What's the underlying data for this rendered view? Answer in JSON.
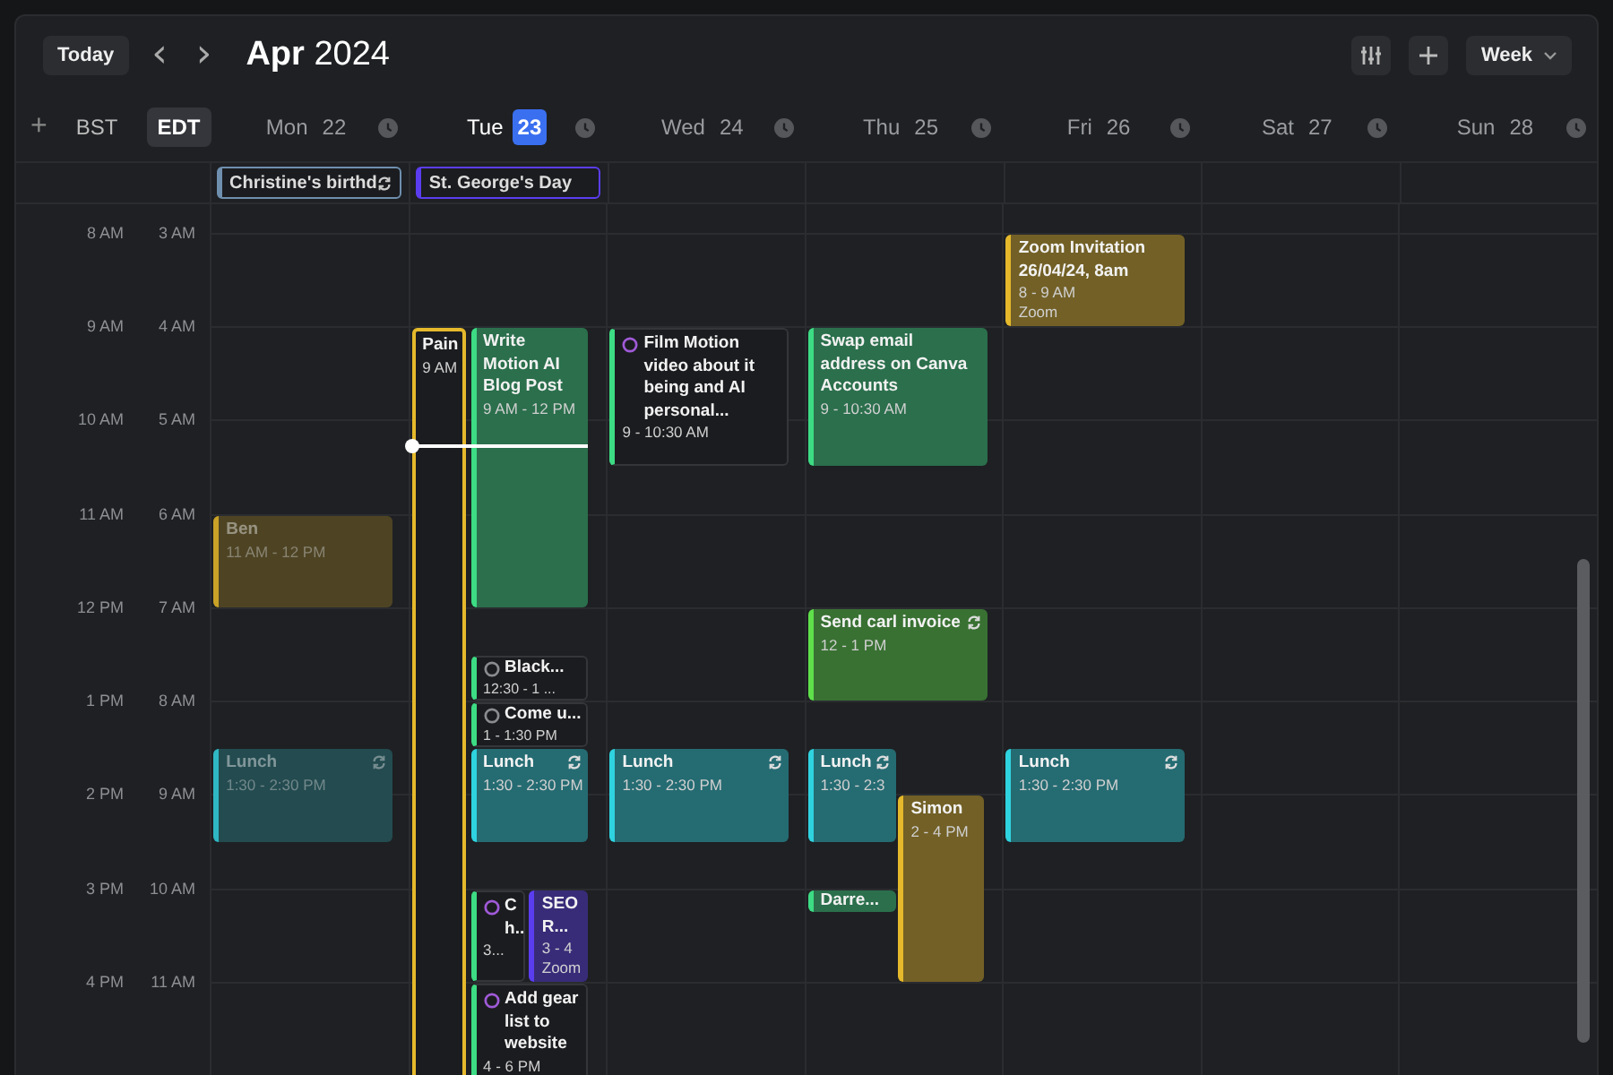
{
  "toolbar": {
    "today": "Today",
    "prev": "‹",
    "next": "›",
    "title": "**Apr** 2024",
    "view": "Week"
  },
  "timezones": {
    "add": "+",
    "zones": [
      {
        "label": "BST",
        "selected": false
      },
      {
        "label": "EDT",
        "selected": true
      }
    ]
  },
  "hours": [
    {
      "primary": "8 AM",
      "secondary": "3 AM"
    },
    {
      "primary": "9 AM",
      "secondary": "4 AM"
    },
    {
      "primary": "10 AM",
      "secondary": "5 AM"
    },
    {
      "primary": "11 AM",
      "secondary": "6 AM"
    },
    {
      "primary": "12 PM",
      "secondary": "7 AM"
    },
    {
      "primary": "1 PM",
      "secondary": "8 AM"
    },
    {
      "primary": "2 PM",
      "secondary": "9 AM"
    },
    {
      "primary": "3 PM",
      "secondary": "10 AM"
    },
    {
      "primary": "4 PM",
      "secondary": "11 AM"
    }
  ],
  "days": [
    {
      "weekday": "Mon",
      "date": "22",
      "selected": false,
      "all_day": [
        {
          "title": "Christine's birthd",
          "color": "#6f8fae",
          "recurring": true
        }
      ],
      "events": [
        {
          "kind": "event",
          "title": "Ben",
          "time": "11 AM - 12 PM",
          "color": "#c9a227",
          "dimmed": true,
          "recurring": false
        },
        {
          "kind": "event",
          "title": "Lunch",
          "time": "1:30 - 2:30 PM",
          "color": "#2fb8c4",
          "dimmed": true,
          "recurring": true
        }
      ]
    },
    {
      "weekday": "Tue",
      "date": "23",
      "selected": true,
      "all_day": [
        {
          "title": "St. George's Day",
          "color": "#5b3df0",
          "recurring": false
        }
      ],
      "events": [
        {
          "kind": "outlined",
          "title": "Pain",
          "time": "9 AM",
          "color": "#e5b92b",
          "dimmed": false,
          "recurring": false
        },
        {
          "kind": "event",
          "title": "Write Motion AI Blog Post",
          "time": "9 AM - 12 PM",
          "color": "#3ddc84",
          "dimmed": false,
          "recurring": false
        },
        {
          "kind": "task",
          "title": "Black...",
          "time": "12:30 - 1 ...",
          "color": "#3ddc84",
          "task": {
            "color": "#8a8c90"
          },
          "dimmed": false,
          "recurring": false
        },
        {
          "kind": "task",
          "title": "Come u...",
          "time": "1 - 1:30 PM",
          "color": "#3ddc84",
          "task": {
            "color": "#8a8c90"
          },
          "dimmed": false,
          "recurring": false
        },
        {
          "kind": "event",
          "title": "Lunch",
          "time": "1:30 - 2:30 PM",
          "color": "#2fd3e0",
          "dimmed": false,
          "recurring": true
        },
        {
          "kind": "task",
          "title": "C h..",
          "time": "3...",
          "color": "#3ddc84",
          "task": {
            "color": "#a05ad8"
          },
          "dimmed": false,
          "recurring": false
        },
        {
          "kind": "event",
          "title": "SEO R...",
          "time": "3 - 4",
          "location": "Zoom",
          "color": "#5b3df0",
          "dimmed": false,
          "recurring": false
        },
        {
          "kind": "task",
          "title": "Add gear list to website",
          "time": "4 - 6 PM",
          "color": "#3ddc84",
          "task": {
            "color": "#a05ad8"
          },
          "dimmed": false,
          "recurring": false
        }
      ]
    },
    {
      "weekday": "Wed",
      "date": "24",
      "selected": false,
      "events": [
        {
          "kind": "task",
          "title": "Film Motion video about it being and AI personal...",
          "time": "9 - 10:30 AM",
          "color": "#3ddc84",
          "task": {
            "color": "#a05ad8"
          },
          "dimmed": false,
          "recurring": false
        },
        {
          "kind": "event",
          "title": "Lunch",
          "time": "1:30 - 2:30 PM",
          "color": "#2fd3e0",
          "dimmed": false,
          "recurring": true
        }
      ]
    },
    {
      "weekday": "Thu",
      "date": "25",
      "selected": false,
      "events": [
        {
          "kind": "event",
          "title": "Swap email address on Canva Accounts",
          "time": "9 - 10:30 AM",
          "color": "#3ddc84",
          "dimmed": false,
          "recurring": false
        },
        {
          "kind": "event",
          "title": "Send carl invoice",
          "time": "12 - 1 PM",
          "color": "#5fe04a",
          "dimmed": false,
          "recurring": true
        },
        {
          "kind": "event",
          "title": "Lunch",
          "time": "1:30 - 2:3",
          "color": "#2fd3e0",
          "dimmed": false,
          "recurring": true
        },
        {
          "kind": "event",
          "title": "Simon",
          "time": "2 - 4 PM",
          "color": "#e5b92b",
          "dimmed": false,
          "recurring": false
        },
        {
          "kind": "event",
          "title": "Darre...",
          "color": "#3ddc84",
          "dimmed": false,
          "recurring": false
        }
      ]
    },
    {
      "weekday": "Fri",
      "date": "26",
      "selected": false,
      "events": [
        {
          "kind": "event",
          "title": "Zoom Invitation 26/04/24, 8am",
          "time": "8 - 9 AM",
          "location": "Zoom",
          "color": "#e5b92b",
          "dimmed": false,
          "recurring": false
        },
        {
          "kind": "event",
          "title": "Lunch",
          "time": "1:30 - 2:30 PM",
          "color": "#2fd3e0",
          "dimmed": false,
          "recurring": true
        }
      ]
    },
    {
      "weekday": "Sat",
      "date": "27",
      "selected": false
    },
    {
      "weekday": "Sun",
      "date": "28",
      "selected": false
    }
  ]
}
